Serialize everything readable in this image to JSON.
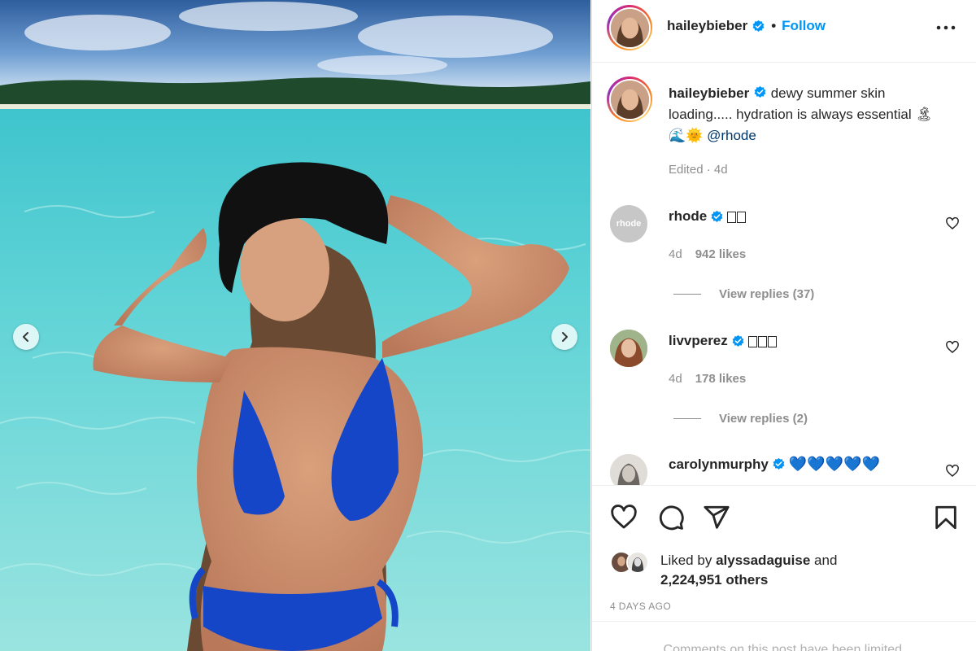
{
  "post": {
    "username": "haileybieber",
    "follow_label": "Follow",
    "separator": "•",
    "caption_text": "dewy summer skin loading..... hydration is always essential 🏝🌊🌞",
    "caption_mention": "@rhode",
    "caption_meta": "Edited · 4d"
  },
  "comments": [
    {
      "username": "rhode",
      "text": "",
      "age": "4d",
      "likes": "942 likes",
      "replies": "View replies (37)",
      "avatar_text": "rhode"
    },
    {
      "username": "livvperez",
      "text": "",
      "age": "4d",
      "likes": "178 likes",
      "replies": "View replies (2)"
    },
    {
      "username": "carolynmurphy",
      "text": "💙💙💙💙💙"
    }
  ],
  "likes": {
    "prefix": "Liked by",
    "user": "alyssadaguise",
    "and": "and",
    "others": "2,224,951 others"
  },
  "timestamp": "4 DAYS AGO",
  "comments_limited": "Comments on this post have been limited.",
  "colors": {
    "follow": "#0095f6",
    "verified": "#0095f6",
    "secondary": "#8e8e8e",
    "mention": "#00376b"
  }
}
